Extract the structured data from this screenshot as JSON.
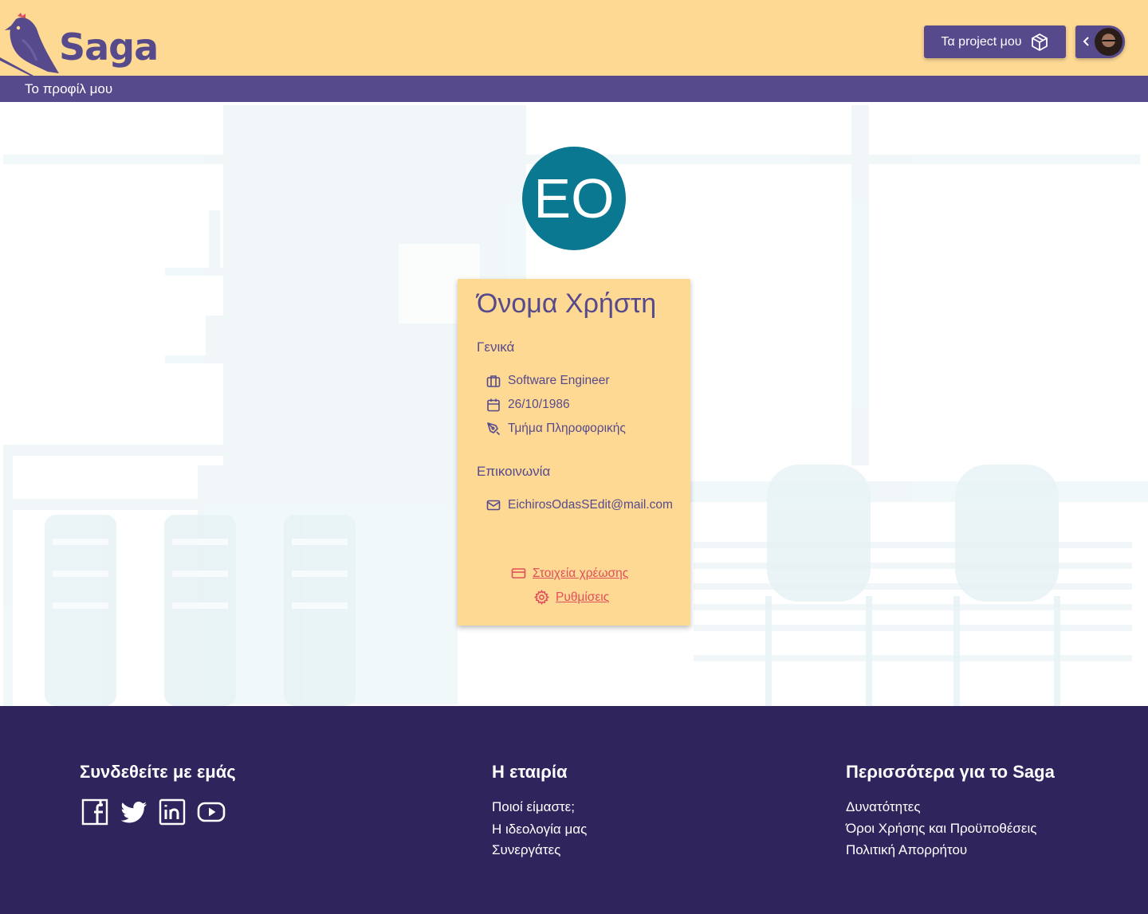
{
  "header": {
    "brand": "Saga",
    "projects_label": "Τα project μου",
    "account_avatar": "user-photo",
    "page_title": "Το προφίλ μου"
  },
  "profile": {
    "initials": "EO",
    "name": "Όνομα Χρήστη",
    "general_title": "Γενικά",
    "job": "Software Engineer",
    "birthdate": "26/10/1986",
    "department": "Τμήμα Πληροφορικής",
    "contact_title": "Επικοινωνία",
    "email": "EichirosOdasSEdit@mail.com",
    "billing_link": "Στοιχεία χρέωσης",
    "settings_link": "Ρυθμίσεις"
  },
  "footer": {
    "connect_title": "Συνδεθείτε με εμάς",
    "social_icons": [
      "facebook-icon",
      "twitter-icon",
      "linkedin-icon",
      "youtube-icon"
    ],
    "company_title": "Η εταιρία",
    "company_links": [
      "Ποιοί είμαστε;",
      "Η ιδεολογία μας",
      "Συνεργάτες"
    ],
    "more_title": "Περισσότερα για το Saga",
    "more_links": [
      "Δυνατότητες",
      "Όροι Χρήσης και Προϋποθέσεις",
      "Πολιτική Απορρήτου"
    ]
  },
  "colors": {
    "header_bg": "#fdd994",
    "brand_purple": "#574a8c",
    "footer_bg": "#30245d",
    "avatar_teal": "#0b7891",
    "link_red": "#e0505c"
  }
}
